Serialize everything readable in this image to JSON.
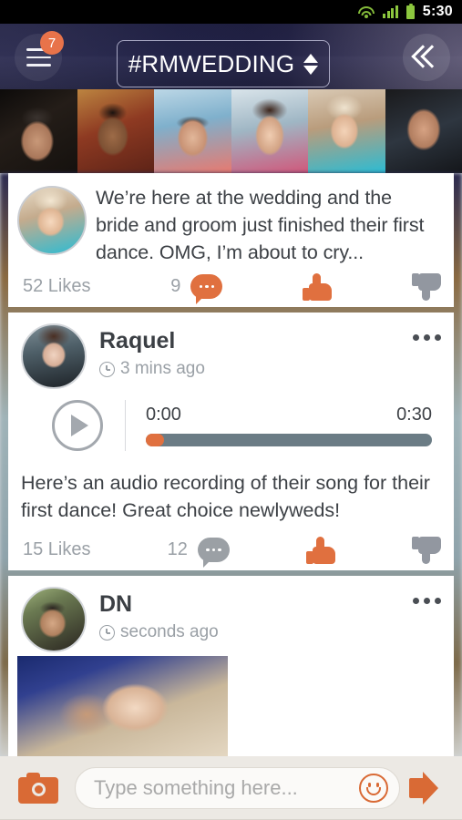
{
  "status_bar": {
    "time": "5:30",
    "icons": [
      "wifi-icon",
      "signal-icon",
      "battery-icon"
    ]
  },
  "header": {
    "menu_badge_count": "7",
    "title": "#RMWEDDING",
    "menu_icon": "hamburger-menu-icon",
    "spinner_icon": "updown-spinner-icon",
    "collapse_icon": "double-chevron-left-icon"
  },
  "participants": [
    {
      "name": "participant-1"
    },
    {
      "name": "participant-2"
    },
    {
      "name": "participant-3"
    },
    {
      "name": "participant-4"
    },
    {
      "name": "participant-5"
    },
    {
      "name": "participant-6"
    }
  ],
  "posts": [
    {
      "text_line1": "We’re here at the wedding and the",
      "text_line2": "bride and groom just finished their first",
      "text_line3": "dance.  OMG, I’m about to cry...",
      "likes": "52 Likes",
      "comment_count": "9",
      "comment_icon": "comment-bubble-icon",
      "thumbs_up_icon": "thumbs-up-icon",
      "thumbs_down_icon": "thumbs-down-icon"
    },
    {
      "author": "Raquel",
      "timestamp": "3 mins ago",
      "clock_icon": "clock-icon",
      "more_icon": "more-options-icon",
      "audio": {
        "play_icon": "play-icon",
        "current_time": "0:00",
        "duration": "0:30",
        "progress_percent": 0
      },
      "text_line1": "Here’s an audio recording of their song for their",
      "text_line2": "first dance!  Great choice newlyweds!",
      "likes": "15 Likes",
      "comment_count": "12",
      "comment_icon": "comment-bubble-icon",
      "thumbs_up_icon": "thumbs-up-icon",
      "thumbs_down_icon": "thumbs-down-icon"
    },
    {
      "author": "DN",
      "timestamp": "seconds ago",
      "clock_icon": "clock-icon",
      "more_icon": "more-options-icon",
      "photos": [
        "wedding-photo-1",
        "wedding-photo-2"
      ]
    }
  ],
  "composer": {
    "camera_icon": "camera-icon",
    "placeholder": "Type something here...",
    "value": "",
    "emoji_icon": "smiley-icon",
    "broadcast_icon": "megaphone-icon"
  },
  "colors": {
    "accent_orange": "#e0703f",
    "camera_orange": "#d96a35",
    "header_navy": "#1c1d42",
    "muted_gray": "#9aa0a6",
    "audio_track": "#6b7c85",
    "composer_bg": "#ece9e4"
  }
}
